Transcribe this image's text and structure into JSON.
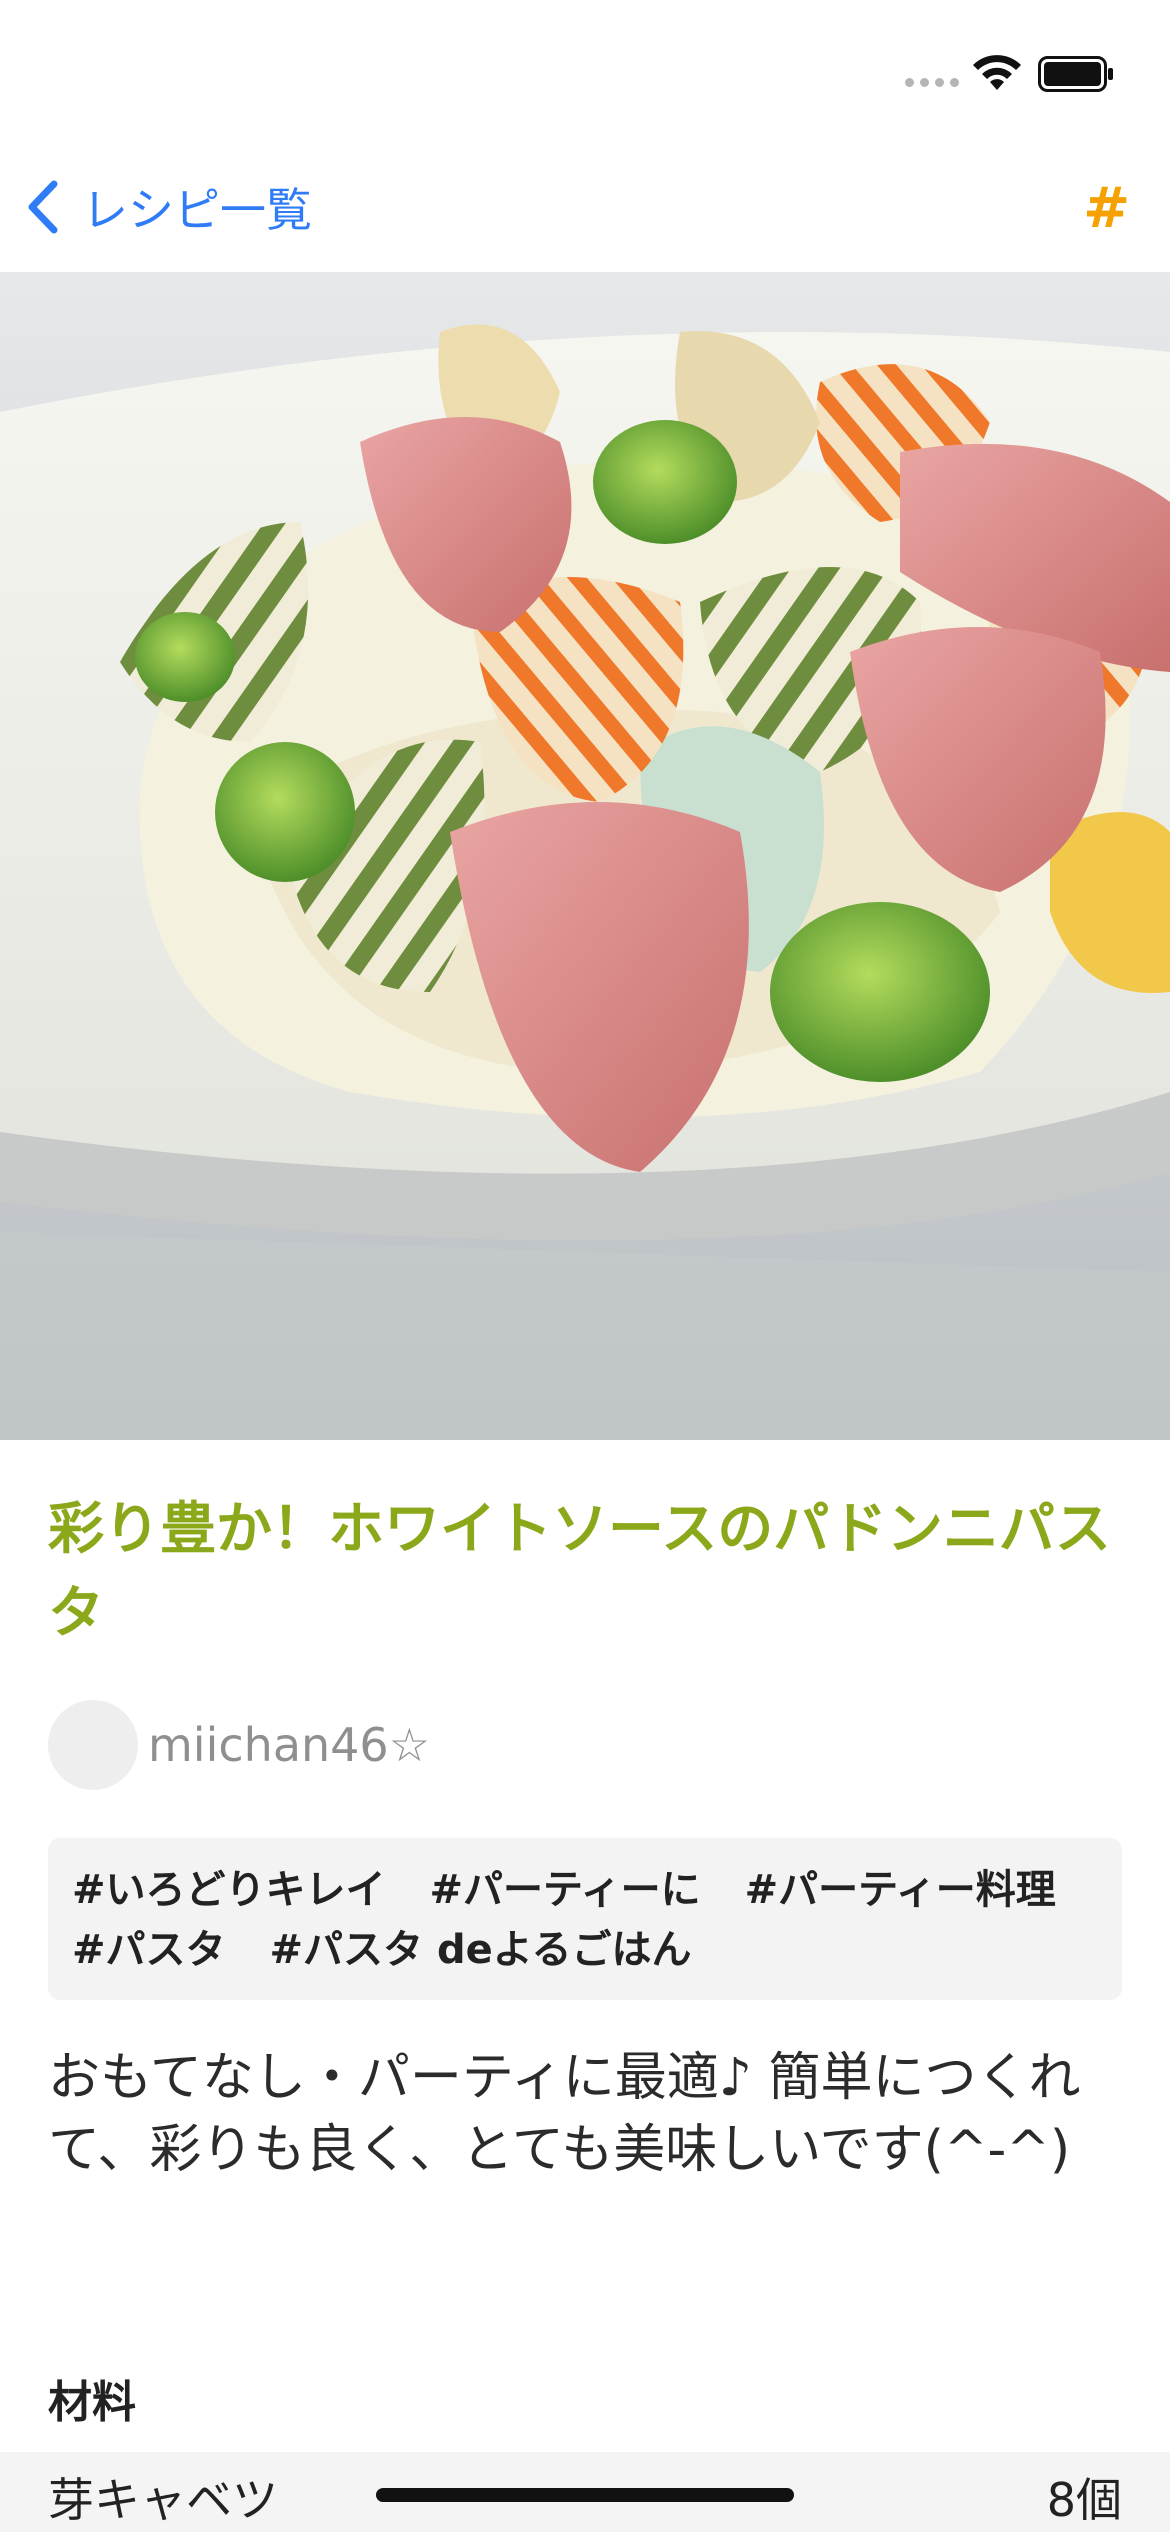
{
  "status_bar": {
    "icons": [
      "signal-dots-icon",
      "wifi-icon",
      "battery-icon"
    ]
  },
  "nav": {
    "back_label": "レシピ一覧",
    "hashtag_label": "#",
    "accent_color": "#2f7cf6",
    "hashtag_color": "#f5a100"
  },
  "recipe": {
    "title": "彩り豊か！ホワイトソースのパドンニパスタ",
    "title_color": "#8aa81a",
    "author": "miichan46☆",
    "tags": [
      [
        "#いろどりキレイ",
        "#パーティーに",
        "#パーティー料理"
      ],
      [
        "#パスタ",
        "#パスタ deよるごはん"
      ]
    ],
    "description": "おもてなし・パーティに最適♪ 簡単につくれて、彩りも良く、とても美味しいです(^-^)"
  },
  "ingredients": {
    "heading": "材料",
    "items": [
      {
        "name": "芽キャベツ",
        "quantity": "8個"
      }
    ]
  }
}
